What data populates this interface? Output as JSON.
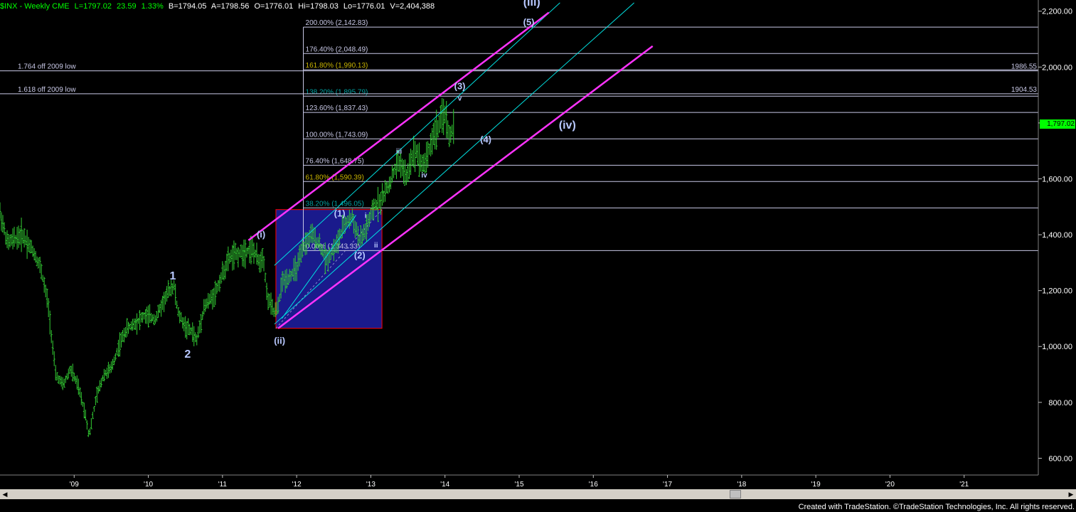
{
  "header": {
    "symbol": "$INX - Weekly  CME",
    "last": "L=1797.02",
    "change": "23.59",
    "change_pct": "1.33%",
    "bid": "B=1794.05",
    "ask": "A=1798.56",
    "open": "O=1776.01",
    "high": "Hi=1798.03",
    "low": "Lo=1776.01",
    "volume": "V=2,404,388"
  },
  "footer": {
    "credit": "Created with TradeStation. ©TradeStation Technologies, Inc. All rights reserved."
  },
  "colors": {
    "background": "#000000",
    "bars": "#33cc33",
    "fib_lines": "#c8c8e6",
    "channel_outer": "#ff33ff",
    "channel_inner": "#00e0e0",
    "box_fill": "#1a1a8c",
    "box_border": "#ff0000",
    "last_price_tag": "#00ff00"
  },
  "chart_data": {
    "type": "candlestick-ohlc-weekly",
    "ylim": [
      540,
      2240
    ],
    "y_ticks": [
      "2,200.00",
      "2,000.00",
      "1,800.00",
      "1,600.00",
      "1,400.00",
      "1,200.00",
      "1,000.00",
      "800.00",
      "600.00"
    ],
    "y_tick_values": [
      2200,
      2000,
      1800,
      1600,
      1400,
      1200,
      1000,
      800,
      600
    ],
    "x_ticks": [
      "'09",
      "'10",
      "'11",
      "'12",
      "'13",
      "'14",
      "'15",
      "'16",
      "'17",
      "'18",
      "'19",
      "'20",
      "'21"
    ],
    "x_tick_years": [
      2009,
      2010,
      2011,
      2012,
      2013,
      2014,
      2015,
      2016,
      2017,
      2018,
      2019,
      2020,
      2021
    ],
    "x_range_years": [
      2008.0,
      2022.0
    ],
    "last_price_label": "1,797.02",
    "last_price": 1797.02,
    "price_path": [
      [
        2008.0,
        1480
      ],
      [
        2008.1,
        1370
      ],
      [
        2008.3,
        1400
      ],
      [
        2008.45,
        1340
      ],
      [
        2008.55,
        1280
      ],
      [
        2008.65,
        1150
      ],
      [
        2008.75,
        900
      ],
      [
        2008.85,
        860
      ],
      [
        2008.95,
        920
      ],
      [
        2009.05,
        860
      ],
      [
        2009.15,
        760
      ],
      [
        2009.2,
        680
      ],
      [
        2009.3,
        820
      ],
      [
        2009.4,
        900
      ],
      [
        2009.5,
        920
      ],
      [
        2009.6,
        1000
      ],
      [
        2009.7,
        1060
      ],
      [
        2009.8,
        1080
      ],
      [
        2009.95,
        1110
      ],
      [
        2010.1,
        1100
      ],
      [
        2010.2,
        1160
      ],
      [
        2010.3,
        1210
      ],
      [
        2010.35,
        1215
      ],
      [
        2010.4,
        1120
      ],
      [
        2010.5,
        1070
      ],
      [
        2010.6,
        1050
      ],
      [
        2010.65,
        1020
      ],
      [
        2010.75,
        1140
      ],
      [
        2010.9,
        1190
      ],
      [
        2011.0,
        1260
      ],
      [
        2011.1,
        1320
      ],
      [
        2011.2,
        1330
      ],
      [
        2011.3,
        1340
      ],
      [
        2011.4,
        1350
      ],
      [
        2011.5,
        1300
      ],
      [
        2011.55,
        1330
      ],
      [
        2011.6,
        1180
      ],
      [
        2011.7,
        1120
      ],
      [
        2011.75,
        1140
      ],
      [
        2011.8,
        1230
      ],
      [
        2011.9,
        1250
      ],
      [
        2012.0,
        1280
      ],
      [
        2012.1,
        1360
      ],
      [
        2012.2,
        1400
      ],
      [
        2012.3,
        1370
      ],
      [
        2012.4,
        1310
      ],
      [
        2012.45,
        1330
      ],
      [
        2012.55,
        1370
      ],
      [
        2012.65,
        1440
      ],
      [
        2012.75,
        1460
      ],
      [
        2012.85,
        1380
      ],
      [
        2012.9,
        1400
      ],
      [
        2012.95,
        1430
      ],
      [
        2013.05,
        1500
      ],
      [
        2013.15,
        1530
      ],
      [
        2013.25,
        1580
      ],
      [
        2013.35,
        1650
      ],
      [
        2013.4,
        1660
      ],
      [
        2013.48,
        1600
      ],
      [
        2013.55,
        1680
      ],
      [
        2013.62,
        1700
      ],
      [
        2013.7,
        1640
      ],
      [
        2013.78,
        1700
      ],
      [
        2013.85,
        1760
      ],
      [
        2013.92,
        1790
      ],
      [
        2014.0,
        1840
      ],
      [
        2014.03,
        1780
      ],
      [
        2014.08,
        1750
      ],
      [
        2014.12,
        1797
      ]
    ],
    "fib_levels": [
      {
        "label": "200.00% (2,142.83)",
        "value": 2142.83
      },
      {
        "label": "176.40% (2,048.49)",
        "value": 2048.49
      },
      {
        "label": "161.80% (1,990.13)",
        "value": 1990.13,
        "color": "#c8b400"
      },
      {
        "label": "138.20% (1,895.79)",
        "value": 1895.79,
        "color": "#00a0a0"
      },
      {
        "label": "123.60% (1,837.43)",
        "value": 1837.43
      },
      {
        "label": "100.00% (1,743.09)",
        "value": 1743.09
      },
      {
        "label": "76.40% (1,648.75)",
        "value": 1648.75
      },
      {
        "label": "61.80% (1,590.39)",
        "value": 1590.39,
        "color": "#c8b400"
      },
      {
        "label": "38.20% (1,496.05)",
        "value": 1496.05,
        "color": "#00a0a0"
      },
      {
        "label": "0.00% (1,343.33)",
        "value": 1343.33
      }
    ],
    "horizontal_levels": [
      {
        "left_label": "1.764 off 2009 low",
        "right_label": "1986.55",
        "value": 1986.55
      },
      {
        "left_label": "1.618 off 2009 low",
        "right_label": "1904.53",
        "value": 1904.53
      }
    ],
    "wave_labels": [
      {
        "text": "1",
        "x": 2010.33,
        "y": 1240,
        "size": "big"
      },
      {
        "text": "2",
        "x": 2010.53,
        "y": 960,
        "size": "big"
      },
      {
        "text": "(i)",
        "x": 2011.52,
        "y": 1390,
        "size": "med"
      },
      {
        "text": "(ii)",
        "x": 2011.77,
        "y": 1010,
        "size": "med"
      },
      {
        "text": "(1)",
        "x": 2012.58,
        "y": 1465,
        "size": "med"
      },
      {
        "text": "(2)",
        "x": 2012.85,
        "y": 1315,
        "size": "med"
      },
      {
        "text": "i",
        "x": 2012.93,
        "y": 1460,
        "size": "small"
      },
      {
        "text": "ii",
        "x": 2013.07,
        "y": 1355,
        "size": "small"
      },
      {
        "text": "iii",
        "x": 2013.38,
        "y": 1690,
        "size": "small"
      },
      {
        "text": "iv",
        "x": 2013.72,
        "y": 1605,
        "size": "small"
      },
      {
        "text": "(3)",
        "x": 2014.2,
        "y": 1920,
        "size": "med"
      },
      {
        "text": "v",
        "x": 2014.2,
        "y": 1880,
        "size": "small"
      },
      {
        "text": "(4)",
        "x": 2014.55,
        "y": 1730,
        "size": "med"
      },
      {
        "text": "(iii)",
        "x": 2015.17,
        "y": 2220,
        "size": "big"
      },
      {
        "text": "(5)",
        "x": 2015.13,
        "y": 2150,
        "size": "med"
      },
      {
        "text": "(iv)",
        "x": 2015.65,
        "y": 1780,
        "size": "big"
      }
    ],
    "channels": {
      "outer": [
        {
          "x1": 2011.35,
          "y1": 1380,
          "x2": 2015.4,
          "y2": 2195
        },
        {
          "x1": 2011.75,
          "y1": 1065,
          "x2": 2016.8,
          "y2": 2075
        }
      ],
      "inner": [
        {
          "x1": 2011.7,
          "y1": 1290,
          "x2": 2015.55,
          "y2": 2230
        },
        {
          "x1": 2011.7,
          "y1": 1080,
          "x2": 2016.55,
          "y2": 2230
        },
        {
          "x1": 2011.8,
          "y1": 1100,
          "x2": 2012.8,
          "y2": 1470
        }
      ]
    },
    "box": {
      "x1": 2011.72,
      "x2": 2013.15,
      "y1": 1065,
      "y2": 1490
    },
    "fib_x_start": 2012.09
  }
}
